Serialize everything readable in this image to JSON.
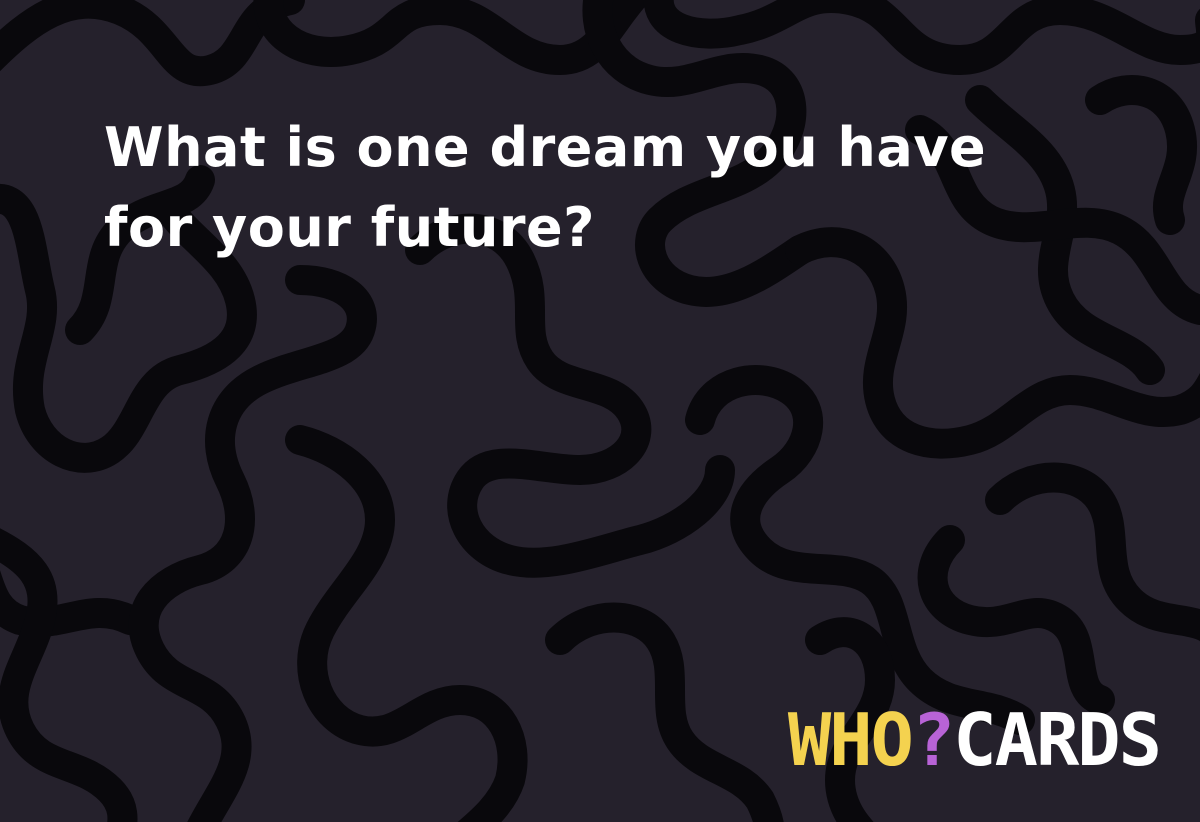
{
  "card": {
    "question": "What is one dream you have for your future?"
  },
  "logo": {
    "who": "WHO",
    "mark": "?",
    "cards": "CARDS"
  },
  "colors": {
    "background": "#25212c",
    "pattern": "#09080c",
    "text": "#ffffff",
    "logo_who": "#f4d24f",
    "logo_mark": "#b863d6",
    "logo_cards": "#ffffff"
  }
}
